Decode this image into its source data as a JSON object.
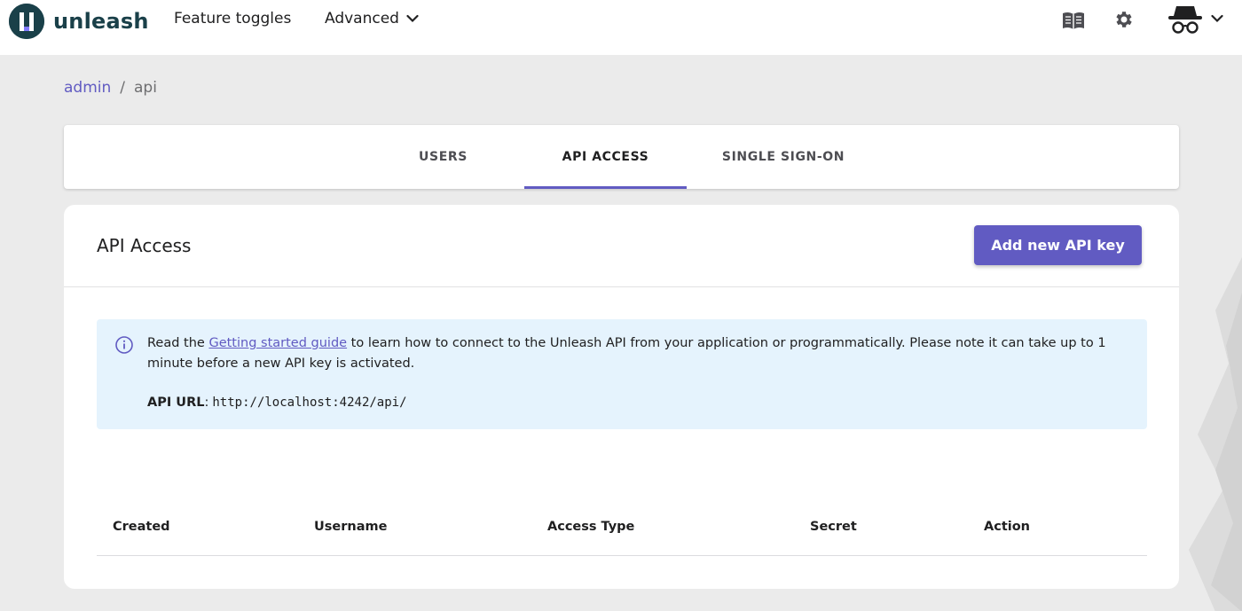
{
  "header": {
    "logo_text": "unleash",
    "nav": {
      "feature_toggles": "Feature toggles",
      "advanced": "Advanced"
    },
    "icons": [
      "documentation-book-icon",
      "settings-gear-icon",
      "user-incognito-icon",
      "chevron-down-icon"
    ]
  },
  "breadcrumb": {
    "root": "admin",
    "separator": "/",
    "current": "api"
  },
  "tabs": [
    {
      "label": "USERS"
    },
    {
      "label": "API ACCESS",
      "active": true
    },
    {
      "label": "SINGLE SIGN-ON"
    }
  ],
  "main": {
    "title": "API Access",
    "add_button": "Add new API key",
    "info": {
      "before_link": "Read the ",
      "link_text": "Getting started guide",
      "after_link": " to learn how to connect to the Unleash API from your application or programmatically. Please note it can take up to 1 minute before a new API key is activated.",
      "api_url_label": "API URL",
      "api_url_sep": ":",
      "api_url_value": "http://localhost:4242/api/"
    },
    "table": {
      "columns": [
        "Created",
        "Username",
        "Access Type",
        "Secret",
        "Action"
      ],
      "rows": []
    }
  },
  "colors": {
    "primary": "#615bc2",
    "logo": "#1a4049",
    "info_bg": "#e5f3fd",
    "page_bg": "#ebebeb"
  }
}
